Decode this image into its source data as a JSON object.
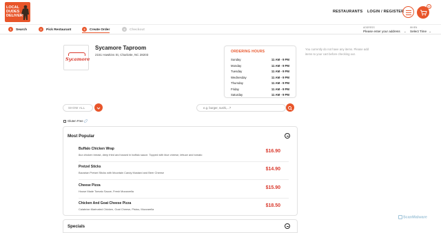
{
  "header": {
    "logo_text": [
      "LOCAL",
      "DUDES",
      "DELIVERY"
    ],
    "nav": [
      "RESTAURANTS",
      "LOGIN / REGISTER"
    ],
    "cart_count": "0",
    "accent_color": "#e8552a"
  },
  "steps": [
    {
      "num": "1",
      "label": "Search",
      "state": "done"
    },
    {
      "num": "2",
      "label": "Pick Restaurant",
      "state": "done"
    },
    {
      "num": "3",
      "label": "Create Order",
      "state": "active"
    },
    {
      "num": "4",
      "label": "Checkout",
      "state": "disabled"
    }
  ],
  "address": {
    "label": "ADDRESS",
    "value": "Please enter your address"
  },
  "when": {
    "label": "WHEN",
    "value": "Select Time"
  },
  "restaurant": {
    "logo_text": "Sycamore",
    "name": "Sycamore Taproom",
    "address": "2151 Hawkins St, Charlotte, NC 28203"
  },
  "hours": {
    "title": "ORDERING HOURS",
    "days": [
      {
        "day": "Sunday",
        "time": "11 AM - 9 PM"
      },
      {
        "day": "Monday",
        "time": "11 AM - 9 PM"
      },
      {
        "day": "Tuesday",
        "time": "11 AM - 9 PM"
      },
      {
        "day": "Wednesday",
        "time": "11 AM - 9 PM"
      },
      {
        "day": "Thursday",
        "time": "11 AM - 9 PM"
      },
      {
        "day": "Friday",
        "time": "11 AM - 9 PM"
      },
      {
        "day": "Saturday",
        "time": "11 AM - 9 PM"
      }
    ]
  },
  "cart": {
    "empty_text": "You currently do not have any items. Please add items to your cart before checking out."
  },
  "filters": {
    "show_all": "SHOW ALL",
    "search_placeholder": "e.g. burger, sushi,...?",
    "gluten_free": "Gluten Free"
  },
  "menu": {
    "section_title": "Most Popular",
    "items": [
      {
        "name": "Buffalo Chicken Wrap",
        "desc": "8oz chicken breast, deep fried and tossed in buffalo sauce. Topped with blue cheese, lettuce and tomato",
        "price": "$16.90"
      },
      {
        "name": "Pretzel Sticks",
        "desc": "Bavarian Pretzel Sticks with Mountain Candy Mustard and Beer Cheese",
        "price": "$14.90"
      },
      {
        "name": "Cheese Pizza",
        "desc": "House Made Tomato Sauce, Fresh Mozzarella",
        "price": "$15.90"
      },
      {
        "name": "Chicken And Goat Cheese Pizza",
        "desc": "Calabrian Marinated Chicken, Goat Cheese, Pistou, Mozzarella",
        "price": "$18.50"
      }
    ],
    "next_section_title": "Specials"
  },
  "watermark": "ScanMalware"
}
